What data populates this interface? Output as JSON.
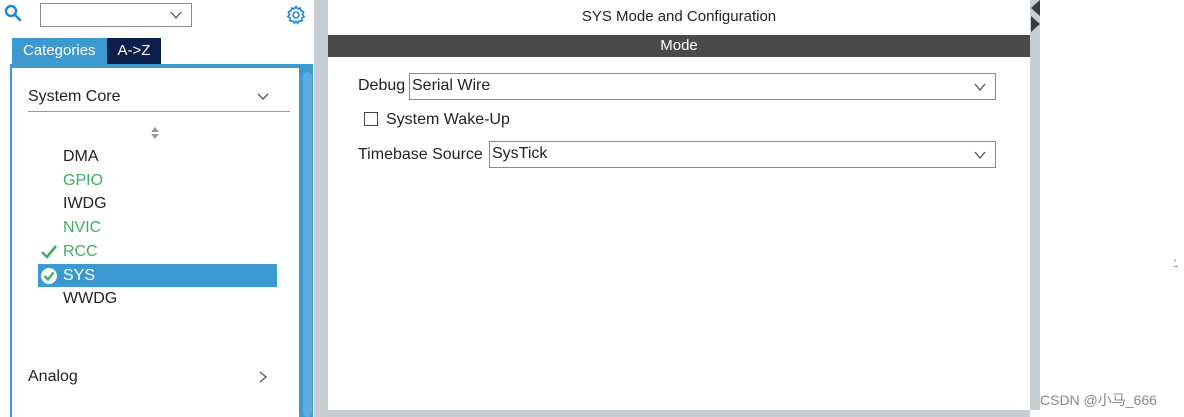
{
  "search": {
    "value": ""
  },
  "tabs": [
    {
      "label": "Categories",
      "active": true
    },
    {
      "label": "A->Z",
      "active": false
    }
  ],
  "categories": {
    "system_core": {
      "label": "System Core",
      "items": [
        {
          "label": "DMA",
          "color": "plain"
        },
        {
          "label": "GPIO",
          "color": "green"
        },
        {
          "label": "IWDG",
          "color": "plain"
        },
        {
          "label": "NVIC",
          "color": "green"
        },
        {
          "label": "RCC",
          "color": "green",
          "mark": "check-icon"
        },
        {
          "label": "SYS",
          "color": "selected",
          "mark": "check-circle-icon"
        },
        {
          "label": "WWDG",
          "color": "plain"
        }
      ]
    },
    "analog": {
      "label": "Analog"
    }
  },
  "main": {
    "title": "SYS Mode and Configuration",
    "section": "Mode",
    "debug": {
      "label": "Debug",
      "value": "Serial Wire"
    },
    "wakeup": {
      "label": "System Wake-Up",
      "checked": false
    },
    "timebase": {
      "label": "Timebase Source",
      "value": "SysTick"
    }
  },
  "watermark": "CSDN @小马_666",
  "colors": {
    "accent": "#3d9ad1",
    "tab_inactive": "#0b1f4a",
    "green_text": "#3db061",
    "mode_bar": "#4a4a4a"
  }
}
